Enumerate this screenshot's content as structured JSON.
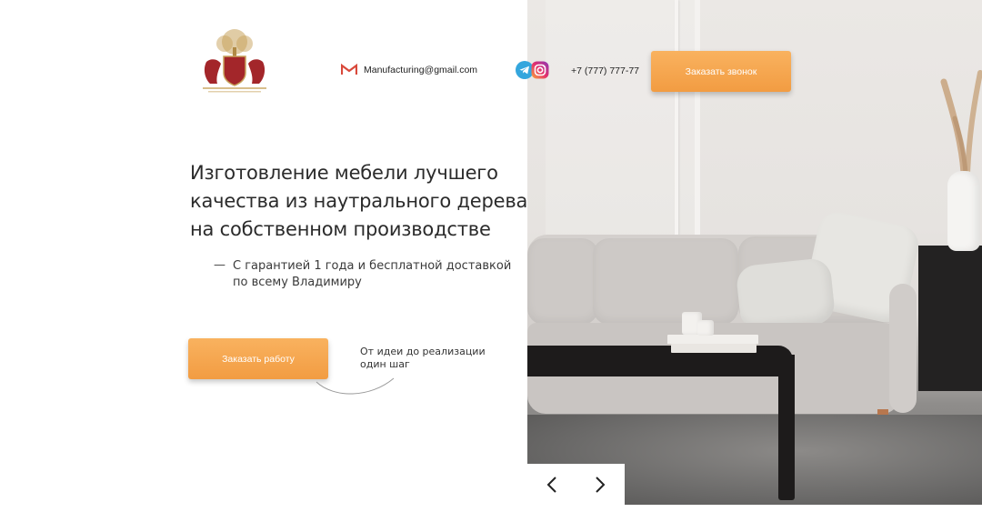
{
  "header": {
    "email": "Manufacturing@gmail.com",
    "phone": "+7 (777) 777-77",
    "call_button": "Заказать звонок",
    "icons": {
      "email": "gmail-icon",
      "telegram": "telegram-icon",
      "instagram": "instagram-icon"
    }
  },
  "hero": {
    "title_lines": [
      "Изготовление мебели лучшего",
      "качества из наутрального дерева",
      "на собственном производстве"
    ],
    "subtitle_dash": "—",
    "subtitle_lines": [
      "С гарантией 1 года и бесплатной доставкой",
      "по всему Владимиру"
    ],
    "order_button": "Заказать работу",
    "note_lines": [
      "От идеи до реализации",
      "один шаг"
    ]
  },
  "slider": {
    "prev_icon": "chevron-left-icon",
    "next_icon": "chevron-right-icon"
  },
  "colors": {
    "accent": "#f4a64e",
    "logo_red": "#a3262a",
    "logo_gold": "#c7a25b",
    "text": "#2b2b2b"
  }
}
